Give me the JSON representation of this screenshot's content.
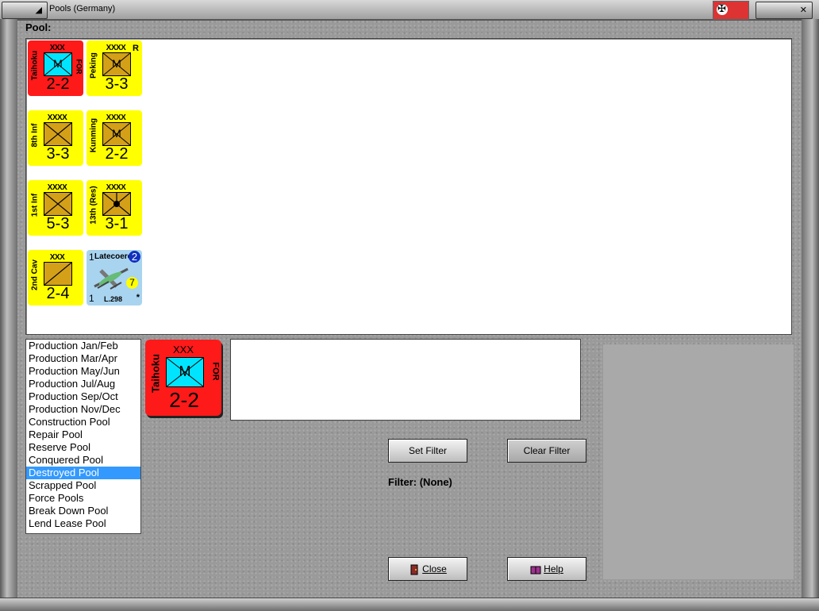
{
  "window": {
    "title": "Pools (Germany)"
  },
  "pool_label": "Pool:",
  "counters": [
    {
      "name": "Taihoku",
      "size": "XXX",
      "symbol": "M",
      "strength": "2-2",
      "tag": "FOR",
      "color": "red",
      "box": "cyan"
    },
    {
      "name": "Peking",
      "size": "XXXX",
      "symbol": "M",
      "strength": "3-3",
      "tag": "R",
      "color": "yellow",
      "box": "gold"
    },
    {
      "name": "8th Inf",
      "size": "XXXX",
      "symbol": "",
      "strength": "3-3",
      "tag": "",
      "color": "yellow",
      "box": "gold"
    },
    {
      "name": "Kunming",
      "size": "XXXX",
      "symbol": "M",
      "strength": "2-2",
      "tag": "",
      "color": "yellow",
      "box": "gold"
    },
    {
      "name": "1st Inf",
      "size": "XXXX",
      "symbol": "",
      "strength": "5-3",
      "tag": "",
      "color": "yellow",
      "box": "gold"
    },
    {
      "name": "13th (Res)",
      "size": "XXXX",
      "symbol": "",
      "strength": "3-1",
      "tag": "",
      "color": "yellow",
      "box": "gold"
    },
    {
      "name": "2nd Cav",
      "size": "XXX",
      "symbol": "",
      "strength": "2-4",
      "tag": "",
      "color": "yellow",
      "box": "gold"
    },
    {
      "name": "Latecoere",
      "model": "L.298",
      "top_left": "1",
      "bottom_left": "1",
      "badge_blue": "2",
      "badge_yellow": "7",
      "star": "*",
      "color": "blue"
    }
  ],
  "list_items": [
    "Production Jan/Feb",
    "Production Mar/Apr",
    "Production May/Jun",
    "Production Jul/Aug",
    "Production Sep/Oct",
    "Production Nov/Dec",
    "Construction Pool",
    "Repair Pool",
    "Reserve Pool",
    "Conquered Pool",
    "Destroyed Pool",
    "Scrapped Pool",
    "Force Pools",
    "Break Down Pool",
    "Lend Lease Pool"
  ],
  "selected_index": 10,
  "selected_counter": {
    "name": "Taihoku",
    "size": "XXX",
    "symbol": "M",
    "strength": "2-2",
    "tag": "FOR"
  },
  "buttons": {
    "set_filter": "Set Filter",
    "clear_filter": "Clear Filter",
    "close": "Close",
    "help": "Help"
  },
  "filter_text": "Filter: (None)",
  "colors": {
    "red": "#ff1a1a",
    "yellow": "#ffff00",
    "cyan": "#00e5ff",
    "gold": "#d4a017",
    "selection": "#3399ff"
  }
}
